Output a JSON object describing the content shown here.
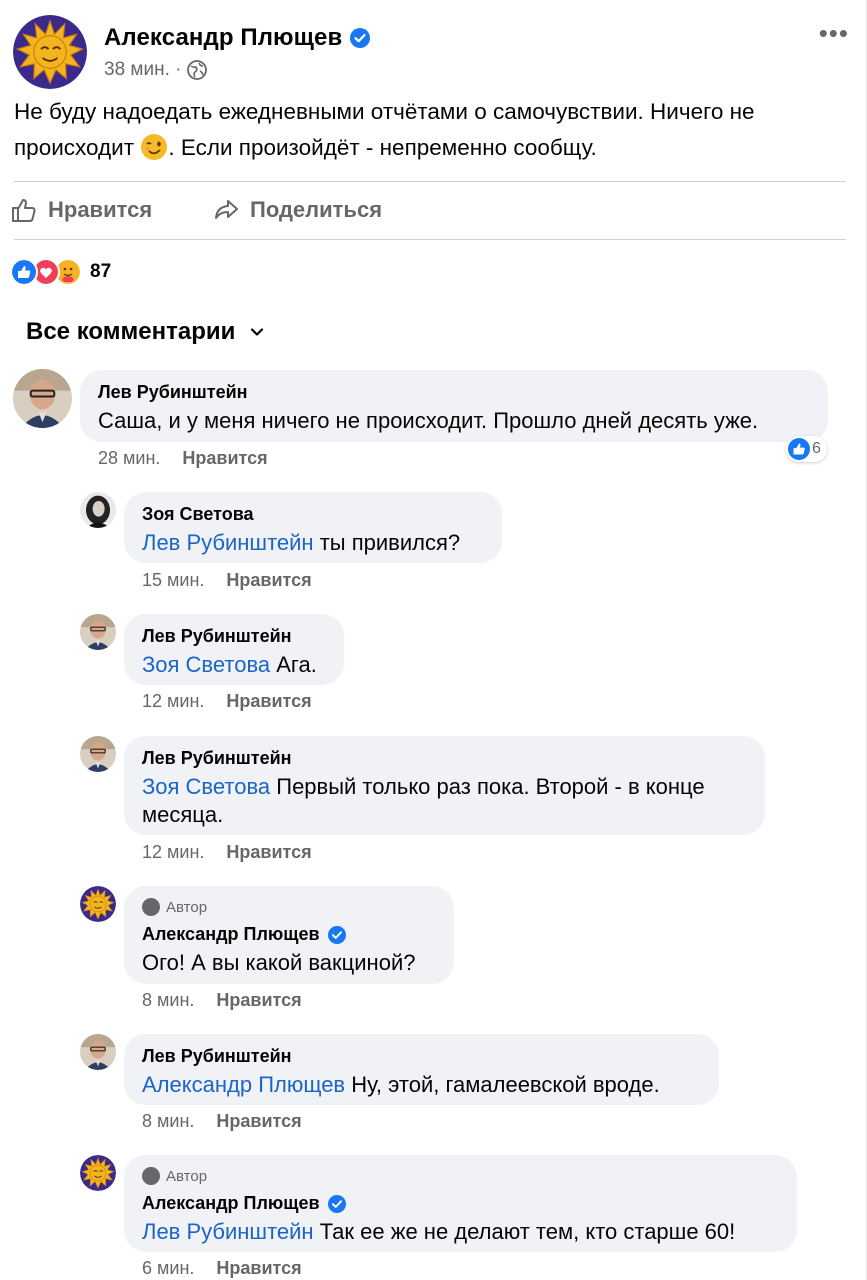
{
  "post": {
    "author": "Александр Плющев",
    "time": "38 мин. ·",
    "text_part1": "Не буду надоедать ежедневными отчётами о самочувствии. Ничего не происходит ",
    "text_part2": ". Если произойдёт - непременно сообщу.",
    "more_label": "•••"
  },
  "actions": {
    "like_label": "Нравится",
    "share_label": "Поделиться"
  },
  "reactions": {
    "count": "87"
  },
  "comments_header": {
    "label": "Все комментарии"
  },
  "comments": [
    {
      "author": "Лев Рубинштейн",
      "mention": "",
      "text": "Саша, и у меня ничего не происходит. Прошло дней десять уже.",
      "time": "28 мин.",
      "like_label": "Нравится",
      "reaction_count": "6"
    },
    {
      "author": "Зоя Светова",
      "mention": "Лев Рубинштейн",
      "text": " ты привился?",
      "time": "15 мин.",
      "like_label": "Нравится"
    },
    {
      "author": "Лев Рубинштейн",
      "mention": "Зоя Светова",
      "text": "Ага.",
      "time": "12 мин.",
      "like_label": "Нравится"
    },
    {
      "author": "Лев Рубинштейн",
      "mention": "Зоя Светова",
      "text_line1": "Первый только раз пока. Второй - в конце",
      "text_line2": "месяца.",
      "time": "12 мин.",
      "like_label": "Нравится"
    },
    {
      "badge": "Автор",
      "author": "Александр Плющев",
      "mention": "",
      "text": "Ого! А вы какой вакциной?",
      "time": "8 мин.",
      "like_label": "Нравится"
    },
    {
      "author": "Лев Рубинштейн",
      "mention": "Александр Плющев",
      "text": "Ну, этой, гамалеевской вроде.",
      "time": "8 мин.",
      "like_label": "Нравится"
    },
    {
      "badge": "Автор",
      "author": "Александр Плющев",
      "mention": "Лев Рубинштейн",
      "text": "Так ее же не делают тем, кто старше 60!",
      "time": "6 мин.",
      "like_label": "Нравится"
    }
  ],
  "colors": {
    "link": "#1b64c8",
    "secondary_text": "#65676b",
    "bubble": "#f0f2f5",
    "verified": "#1877f2",
    "like_blue": "#1877f2",
    "love_red": "#f33e58",
    "care_yellow": "#f7b125"
  },
  "icons": [
    "sun-logo-avatar",
    "verified-badge-icon",
    "globe-icon",
    "more-icon",
    "thumbs-up-icon",
    "share-icon",
    "like-reaction-icon",
    "love-reaction-icon",
    "care-reaction-icon",
    "chevron-down-icon",
    "wink-emoji-icon"
  ]
}
